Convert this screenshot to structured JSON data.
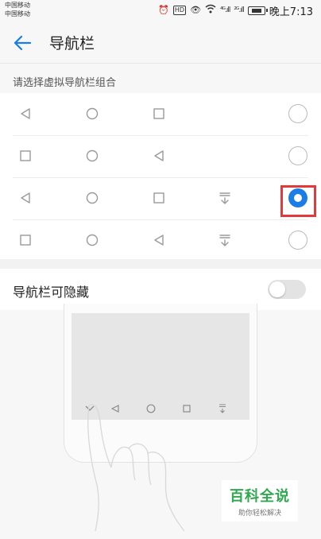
{
  "status_bar": {
    "carrier_1": "中国移动",
    "carrier_2": "中国移动",
    "signal_1": "⁴ᴳ.ıll",
    "signal_2": "²ᴳ.ıll",
    "time": "晚上7:13"
  },
  "app_bar": {
    "title": "导航栏"
  },
  "nav_layout": {
    "header": "请选择虚拟导航栏组合",
    "selected_index": 2,
    "options": [
      {
        "keys": [
          "back-icon",
          "home-icon",
          "recent-icon"
        ],
        "selected": false
      },
      {
        "keys": [
          "recent-icon",
          "home-icon",
          "back-icon"
        ],
        "selected": false
      },
      {
        "keys": [
          "back-icon",
          "home-icon",
          "recent-icon",
          "notification-icon"
        ],
        "selected": true
      },
      {
        "keys": [
          "recent-icon",
          "home-icon",
          "back-icon",
          "notification-icon"
        ],
        "selected": false
      }
    ]
  },
  "hide_toggle": {
    "label": "导航栏可隐藏",
    "enabled": false
  },
  "illustration": {
    "keys": [
      "hide-chevron-icon",
      "back-icon",
      "home-icon",
      "recent-icon",
      "notification-icon"
    ]
  },
  "watermark": {
    "title": "百科全说",
    "subtitle": "助你轻松解决"
  },
  "colors": {
    "accent": "#1a7ce6",
    "highlight": "#e23a3a",
    "watermark": "#2fa84f"
  }
}
